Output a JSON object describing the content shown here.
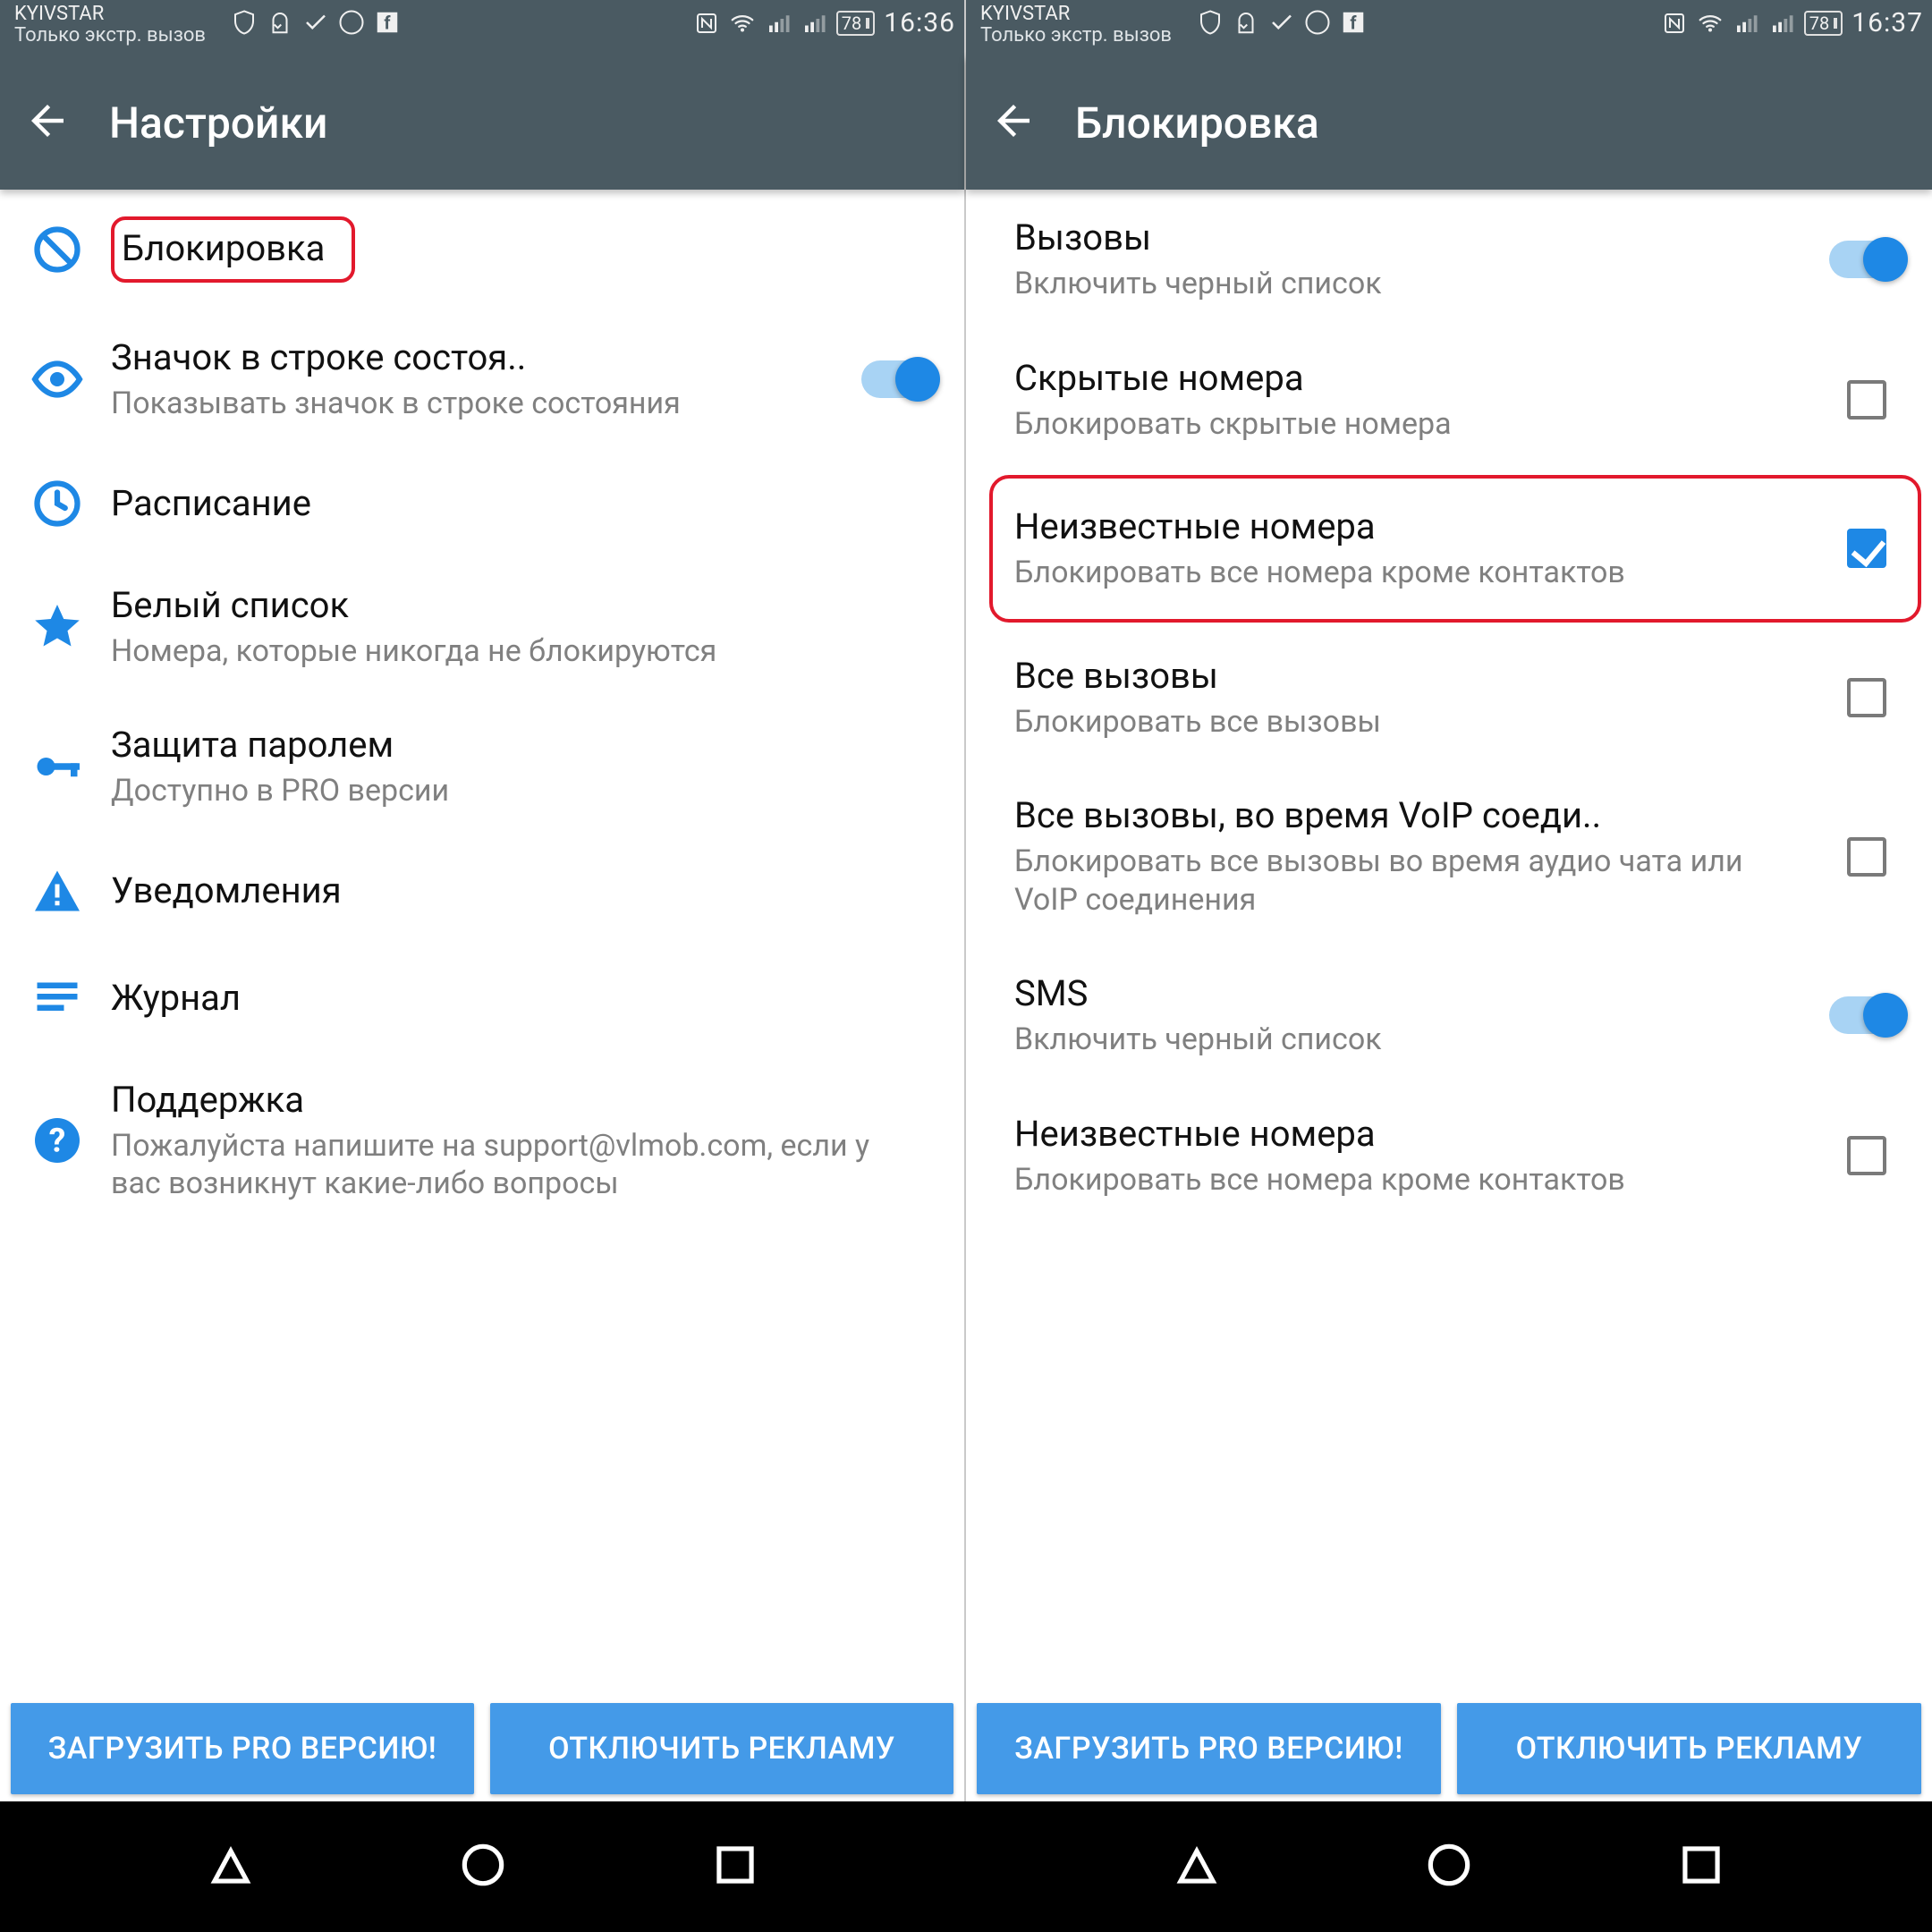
{
  "left": {
    "status": {
      "carrier": "KYIVSTAR",
      "sub": "Только экстр. вызов",
      "battery": "78",
      "time": "16:36"
    },
    "title": "Настройки",
    "items": [
      {
        "title": "Блокировка",
        "sub": "",
        "icon": "block"
      },
      {
        "title": "Значок в строке состоя..",
        "sub": "Показывать значок в строке состояния",
        "icon": "eye"
      },
      {
        "title": "Расписание",
        "sub": "",
        "icon": "clock"
      },
      {
        "title": "Белый список",
        "sub": "Номера, которые никогда не блокируются",
        "icon": "star"
      },
      {
        "title": "Защита паролем",
        "sub": "Доступно в PRO версии",
        "icon": "key"
      },
      {
        "title": "Уведомления",
        "sub": "",
        "icon": "alert"
      },
      {
        "title": "Журнал",
        "sub": "",
        "icon": "lines"
      },
      {
        "title": "Поддержка",
        "sub": "Пожалуйста напишите на support@vlmob.com, если у вас возникнут какие-либо вопросы",
        "icon": "help"
      }
    ],
    "promo": {
      "pro": "ЗАГРУЗИТЬ PRO ВЕРСИЮ!",
      "ads": "ОТКЛЮЧИТЬ РЕКЛАМУ"
    }
  },
  "right": {
    "status": {
      "carrier": "KYIVSTAR",
      "sub": "Только экстр. вызов",
      "battery": "78",
      "time": "16:37"
    },
    "title": "Блокировка",
    "items": [
      {
        "title": "Вызовы",
        "sub": "Включить черный список",
        "ctrl": "switch-on"
      },
      {
        "title": "Скрытые номера",
        "sub": "Блокировать скрытые номера",
        "ctrl": "checkbox-off"
      },
      {
        "title": "Неизвестные номера",
        "sub": "Блокировать все номера кроме контактов",
        "ctrl": "checkbox-on"
      },
      {
        "title": "Все вызовы",
        "sub": "Блокировать все вызовы",
        "ctrl": "checkbox-off"
      },
      {
        "title": "Все вызовы, во время VoIP соеди..",
        "sub": "Блокировать все вызовы во время аудио чата или VoIP соединения",
        "ctrl": "checkbox-off"
      },
      {
        "title": "SMS",
        "sub": "Включить черный список",
        "ctrl": "switch-on"
      },
      {
        "title": "Неизвестные номера",
        "sub": "Блокировать все номера кроме контактов",
        "ctrl": "checkbox-off"
      }
    ],
    "promo": {
      "pro": "ЗАГРУЗИТЬ PRO ВЕРСИЮ!",
      "ads": "ОТКЛЮЧИТЬ РЕКЛАМУ"
    }
  }
}
